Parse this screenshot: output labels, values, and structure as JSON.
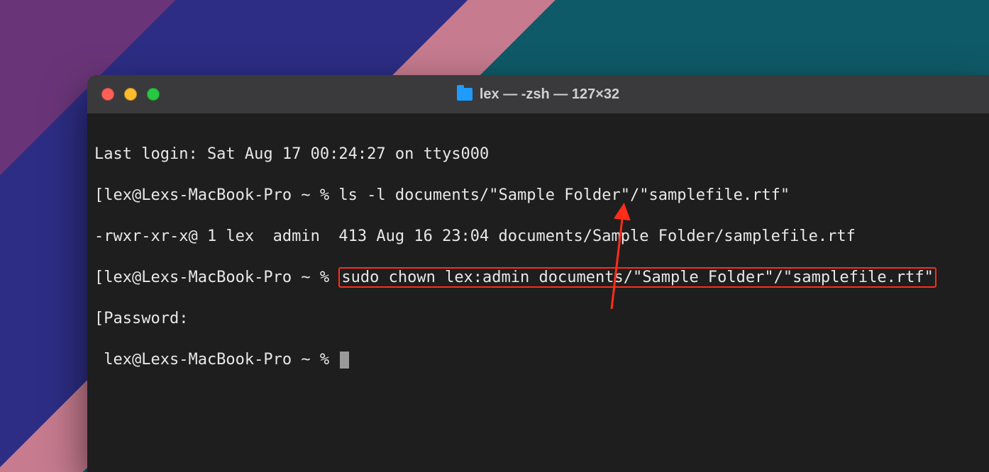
{
  "window": {
    "title": "lex — -zsh — 127×32"
  },
  "terminal": {
    "line1": "Last login: Sat Aug 17 00:24:27 on ttys000",
    "prompt2_prefix": "[lex@Lexs-MacBook-Pro ~ % ",
    "prompt2_cmd": "ls -l documents/\"Sample Folder\"/\"samplefile.rtf\"",
    "line3": "-rwxr-xr-x@ 1 lex  admin  413 Aug 16 23:04 documents/Sample Folder/samplefile.rtf",
    "prompt4_prefix": "[lex@Lexs-MacBook-Pro ~ % ",
    "prompt4_cmd": "sudo chown lex:admin documents/\"Sample Folder\"/\"samplefile.rtf\"",
    "line5": "[Password:",
    "prompt6": " lex@Lexs-MacBook-Pro ~ % "
  },
  "colors": {
    "highlight": "#ff2d1a",
    "terminal_bg": "#1e1e1e",
    "titlebar_bg": "#3a3a3c"
  }
}
